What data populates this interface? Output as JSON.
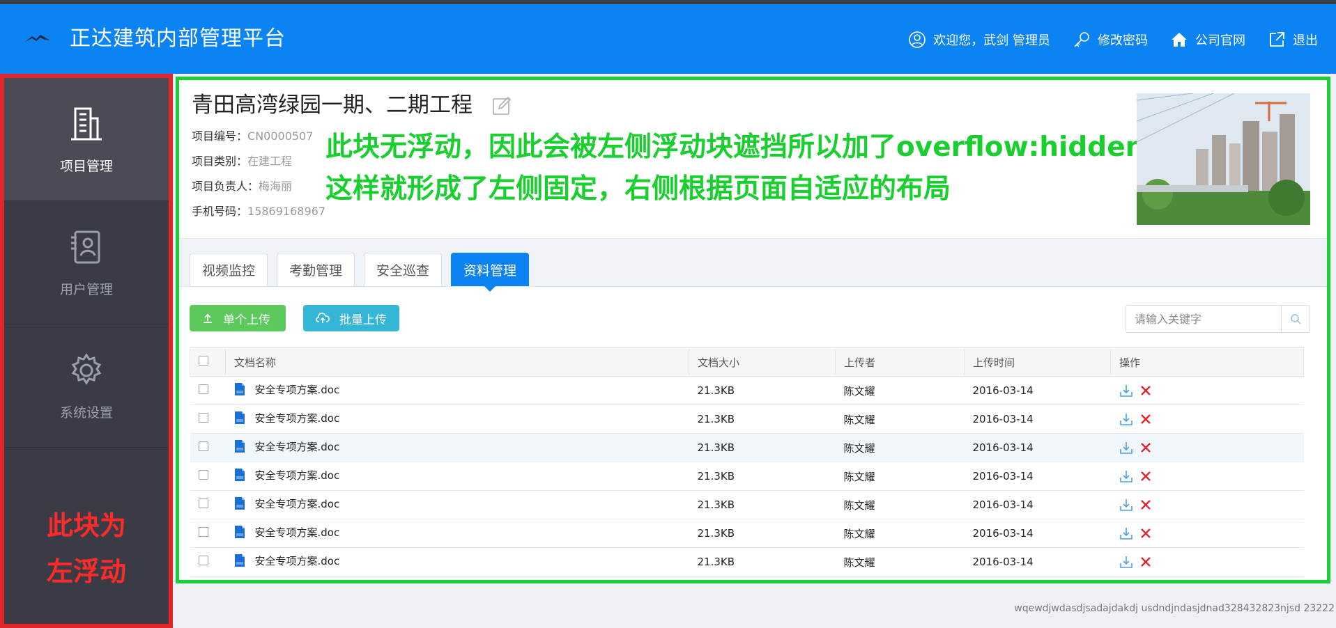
{
  "header": {
    "app_title": "正达建筑内部管理平台",
    "nav": [
      {
        "label": "欢迎您，武剑 管理员",
        "icon": "user-icon"
      },
      {
        "label": "修改密码",
        "icon": "key-icon"
      },
      {
        "label": "公司官网",
        "icon": "home-icon"
      },
      {
        "label": "退出",
        "icon": "logout-icon"
      }
    ]
  },
  "sidebar": {
    "items": [
      {
        "label": "项目管理",
        "icon": "building-icon",
        "active": true
      },
      {
        "label": "用户管理",
        "icon": "contacts-icon",
        "active": false
      },
      {
        "label": "系统设置",
        "icon": "gear-icon",
        "active": false
      }
    ],
    "note": [
      "此块为",
      "左浮动"
    ]
  },
  "project": {
    "title": "青田高湾绿园一期、二期工程",
    "fields": [
      {
        "label": "项目编号：",
        "value": "CN0000507"
      },
      {
        "label": "项目类别：",
        "value": "在建工程"
      },
      {
        "label": "项目负责人：",
        "value": "梅海丽"
      },
      {
        "label": "手机号码：",
        "value": "15869168967"
      }
    ],
    "note_lines": [
      "此块无浮动，因此会被左侧浮动块遮挡所以加了overflow:hidden",
      "这样就形成了左侧固定，右侧根据页面自适应的布局"
    ]
  },
  "tabs": [
    {
      "label": "视频监控",
      "active": false
    },
    {
      "label": "考勤管理",
      "active": false
    },
    {
      "label": "安全巡查",
      "active": false
    },
    {
      "label": "资料管理",
      "active": true
    }
  ],
  "toolbar": {
    "single_upload": "单个上传",
    "batch_upload": "批量上传",
    "search_placeholder": "请输入关键字"
  },
  "table": {
    "headers": [
      "文档名称",
      "文档大小",
      "上传者",
      "上传时间",
      "操作"
    ],
    "rows": [
      {
        "name": "安全专项方案.doc",
        "size": "21.3KB",
        "uploader": "陈文耀",
        "time": "2016-03-14"
      },
      {
        "name": "安全专项方案.doc",
        "size": "21.3KB",
        "uploader": "陈文耀",
        "time": "2016-03-14"
      },
      {
        "name": "安全专项方案.doc",
        "size": "21.3KB",
        "uploader": "陈文耀",
        "time": "2016-03-14"
      },
      {
        "name": "安全专项方案.doc",
        "size": "21.3KB",
        "uploader": "陈文耀",
        "time": "2016-03-14"
      },
      {
        "name": "安全专项方案.doc",
        "size": "21.3KB",
        "uploader": "陈文耀",
        "time": "2016-03-14"
      },
      {
        "name": "安全专项方案.doc",
        "size": "21.3KB",
        "uploader": "陈文耀",
        "time": "2016-03-14"
      },
      {
        "name": "安全专项方案.doc",
        "size": "21.3KB",
        "uploader": "陈文耀",
        "time": "2016-03-14"
      }
    ]
  },
  "footer": {
    "watermark": "wqewdjwdasdjsadajdakdj usdndjndasjdnad328432823njsd 23222"
  },
  "colors": {
    "header_bg": "#0b83f2",
    "sidebar_bg": "#3b3b45",
    "active_tab": "#0b83f2",
    "sidebar_outline": "#e0262b",
    "content_outline": "#1ccf3a",
    "single_upload_bg": "#5cc95c",
    "batch_upload_bg": "#36b6d6"
  }
}
